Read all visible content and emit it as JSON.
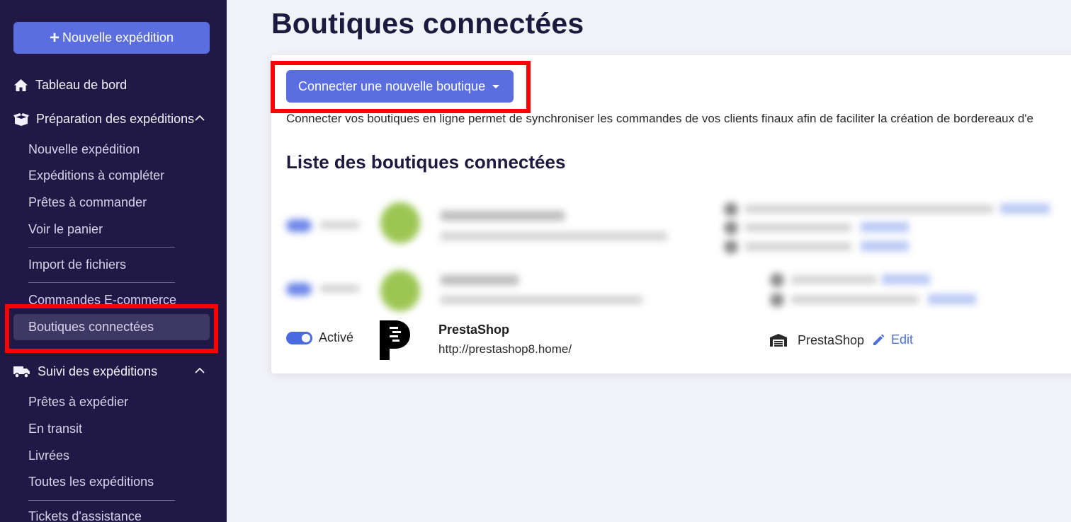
{
  "sidebar": {
    "new_button": "Nouvelle expédition",
    "dashboard": "Tableau de bord",
    "preparation": {
      "label": "Préparation des expéditions",
      "items": [
        "Nouvelle expédition",
        "Expéditions à compléter",
        "Prêtes à commander",
        "Voir le panier"
      ],
      "import": "Import de fichiers",
      "ecommerce": "Commandes E-commerce",
      "connected": "Boutiques connectées"
    },
    "tracking": {
      "label": "Suivi des expéditions",
      "items": [
        "Prêtes à expédier",
        "En transit",
        "Livrées",
        "Toutes les expéditions"
      ]
    },
    "support": "Tickets d'assistance"
  },
  "main": {
    "title": "Boutiques connectées",
    "connect_button": "Connecter une nouvelle boutique",
    "description": "Connecter vos boutiques en ligne permet de synchroniser les commandes de vos clients finaux afin de faciliter la création de bordereaux d'e",
    "list_title": "Liste des boutiques connectées",
    "shops": [
      {
        "status": "Activé",
        "name": "PrestaShop",
        "url": "http://prestashop8.home/",
        "platform": "PrestaShop",
        "edit_label": "Edit"
      }
    ]
  },
  "colors": {
    "sidebar_bg": "#201945",
    "accent": "#5a6ee0",
    "highlight": "#ff0000",
    "link": "#4d6fe0"
  }
}
